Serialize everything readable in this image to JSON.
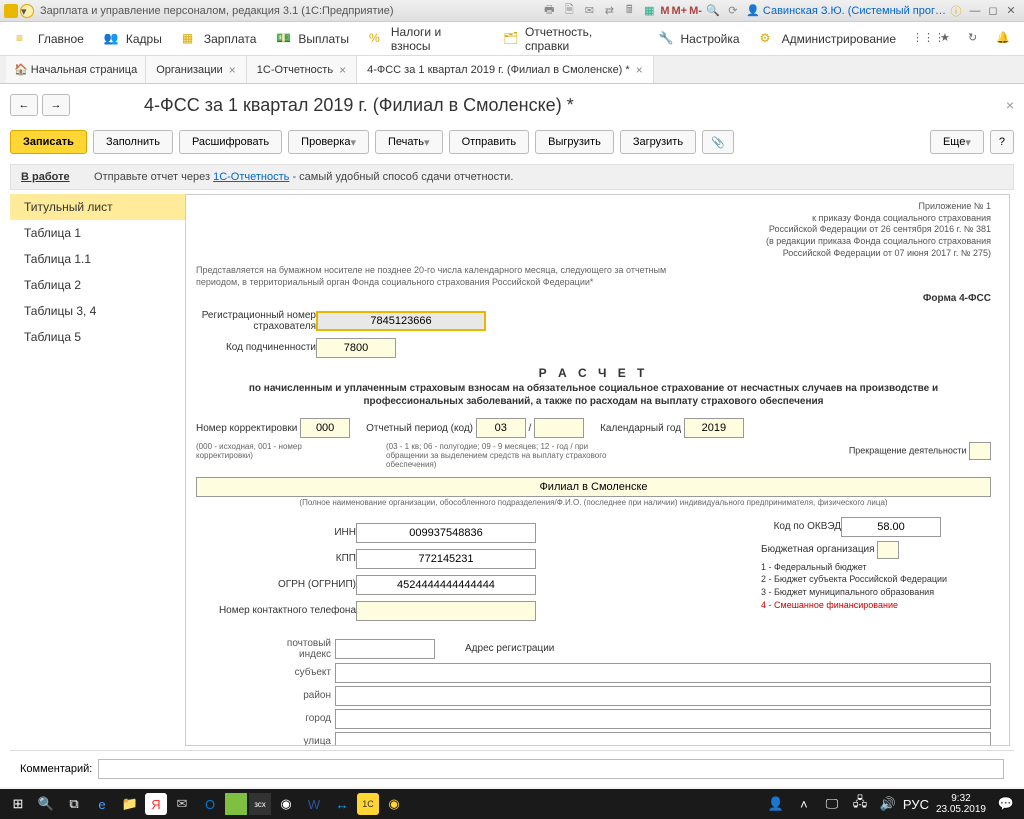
{
  "titlebar": {
    "app_title": "Зарплата и управление персоналом, редакция 3.1  (1С:Предприятие)",
    "user": "Савинская З.Ю. (Системный прог…"
  },
  "menu": {
    "main": "Главное",
    "hr": "Кадры",
    "salary": "Зарплата",
    "payments": "Выплаты",
    "taxes": "Налоги и взносы",
    "reports": "Отчетность, справки",
    "settings": "Настройка",
    "admin": "Администрирование"
  },
  "tabs": {
    "home": "Начальная страница",
    "org": "Организации",
    "reporting": "1С-Отчетность",
    "active": "4-ФСС за 1 квартал 2019 г. (Филиал в Смоленске) *"
  },
  "page_title": "4-ФСС за 1 квартал 2019 г. (Филиал в Смоленске) *",
  "toolbar": {
    "save": "Записать",
    "fill": "Заполнить",
    "decode": "Расшифровать",
    "check": "Проверка",
    "print": "Печать",
    "send": "Отправить",
    "export": "Выгрузить",
    "load": "Загрузить",
    "more": "Еще"
  },
  "infobar": {
    "status": "В работе",
    "text1": "Отправьте отчет через ",
    "link": "1С-Отчетность",
    "text2": " - самый удобный способ сдачи отчетности."
  },
  "sidebar": {
    "items": [
      "Титульный лист",
      "Таблица 1",
      "Таблица 1.1",
      "Таблица 2",
      "Таблицы 3, 4",
      "Таблица 5"
    ]
  },
  "form": {
    "appendix": [
      "Приложение № 1",
      "к приказу Фонда социального страхования",
      "Российской Федерации от 26 сентября 2016 г. № 381",
      "(в редакции приказа Фонда социального страхования",
      "Российской Федерации от 07 июня 2017 г. № 275)"
    ],
    "note": "Представляется на бумажном носителе не позднее 20-го числа календарного месяца, следующего за отчетным периодом, в территориальный орган Фонда социального страхования Российской Федерации*",
    "formcode": "Форма 4-ФСС",
    "reg_label": "Регистрационный номер страхователя",
    "reg_value": "7845123666",
    "sub_label": "Код подчиненности",
    "sub_value": "7800",
    "title": "Р А С Ч Е Т",
    "subtitle": "по начисленным и уплаченным страховым взносам на обязательное социальное страхование от несчастных случаев на производстве и профессиональных заболеваний, а также по расходам на выплату страхового обеспечения",
    "corr_label": "Номер корректировки",
    "corr_value": "000",
    "period_label": "Отчетный период (код)",
    "period_value": "03",
    "period_sep": "/",
    "year_label": "Календарный год",
    "year_value": "2019",
    "corr_note": "(000 - исходная, 001 - номер корректировки)",
    "period_note": "(03 - 1 кв; 06 - полугодие; 09 - 9 месяцев; 12 - год / при обращении за выделением средств на выплату страхового обеспечения)",
    "cease_label": "Прекращение деятельности",
    "org_name": "Филиал в Смоленске",
    "org_note": "(Полное наименование организации, обособленного подразделения/Ф.И.О. (последнее при наличии) индивидуального предпринимателя, физического лица)",
    "inn_label": "ИНН",
    "inn_value": "009937548836",
    "okved_label": "Код по ОКВЭД",
    "okved_value": "58.00",
    "kpp_label": "КПП",
    "kpp_value": "772145231",
    "budget_label": "Бюджетная организация",
    "budget_lines": [
      "1 - Федеральный бюджет",
      "2 - Бюджет субъекта Российской Федерации",
      "3 - Бюджет муниципального образования",
      "4 - Смешанное финансирование"
    ],
    "ogrn_label": "ОГРН (ОГРНИП)",
    "ogrn_value": "4524444444444444",
    "phone_label": "Номер контактного телефона",
    "addr_title": "Адрес регистрации",
    "zip_label": "почтовый индекс",
    "subj_label": "субъект",
    "district_label": "район",
    "city_label": "город",
    "street_label": "улица"
  },
  "comment_label": "Комментарий:",
  "taskbar": {
    "lang": "РУС",
    "time": "9:32",
    "date": "23.05.2019"
  }
}
